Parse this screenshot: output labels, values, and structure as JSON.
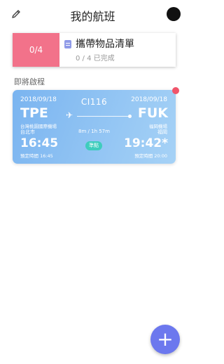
{
  "header": {
    "title": "我的航班",
    "edit_icon": "pencil-icon",
    "avatar_icon": "avatar-icon"
  },
  "checklist": {
    "progress_text": "0/4",
    "progress_value": 0,
    "title": "攜帶物品清單",
    "subtitle": "0 / 4 已完成",
    "icon": "clipboard-icon"
  },
  "section": {
    "label": "即將啟程"
  },
  "flight": {
    "number": "CI116",
    "departure": {
      "date": "2018/09/18",
      "code": "TPE",
      "airport": "台灣桃園國際機場",
      "city": "台北市",
      "time": "16:45",
      "scheduled": "預定時間 16:45"
    },
    "arrival": {
      "date": "2018/09/18",
      "code": "FUK",
      "airport": "福岡機場",
      "city": "福岡",
      "time": "19:42*",
      "scheduled": "預定時間 20:00"
    },
    "duration": "8m / 1h 57m",
    "status": "準點",
    "plane_icon": "airplane-icon"
  },
  "fab": {
    "label": "+",
    "icon": "plus-icon"
  },
  "colors": {
    "checklist_progress": "#f2728a",
    "card_gradient_start": "#7ab4f0",
    "card_gradient_end": "#a6d2f6",
    "status_badge": "#3ecdbd",
    "notification_dot": "#f0546a",
    "fab": "#6c78ee",
    "clip_icon": "#8f9ae8"
  }
}
